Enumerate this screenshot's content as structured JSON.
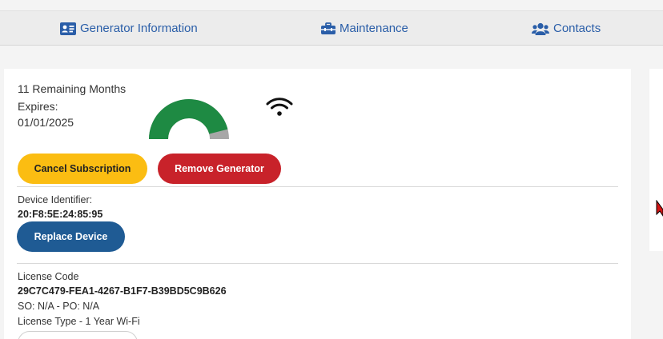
{
  "nav": {
    "generator_info": "Generator Information",
    "maintenance": "Maintenance",
    "contacts": "Contacts"
  },
  "subscription": {
    "remaining": "11 Remaining Months",
    "expires_label": "Expires:",
    "expires_date": "01/01/2025",
    "remaining_fraction": 0.92
  },
  "buttons": {
    "cancel_subscription": "Cancel Subscription",
    "remove_generator": "Remove Generator",
    "replace_device": "Replace Device"
  },
  "device": {
    "identifier_label": "Device Identifier:",
    "identifier_value": "20:F8:5E:24:85:95"
  },
  "license": {
    "code_label": "License Code",
    "code_value": "29C7C479-FEA1-4267-B1F7-B39BD5C9B626",
    "so_po": "SO: N/A - PO: N/A",
    "type": "License Type - 1 Year Wi-Fi"
  },
  "colors": {
    "nav_text": "#2a5ea8",
    "gauge_fill": "#1e8a43",
    "gauge_empty": "#a7a7a7",
    "cancel_button": "#fbbd12",
    "remove_button": "#c8222a",
    "replace_button": "#1f5b94"
  },
  "icons": {
    "generator_info": "id-card-icon",
    "maintenance": "toolbox-icon",
    "contacts": "users-icon",
    "connection": "wifi-icon"
  }
}
